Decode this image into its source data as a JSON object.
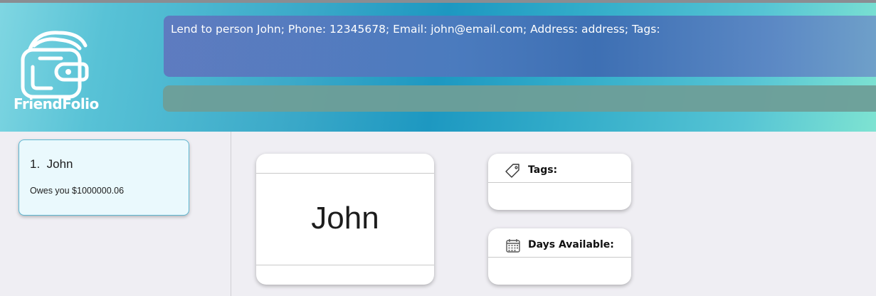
{
  "app": {
    "logo_text": "FriendFolio"
  },
  "result_display": {
    "text": "Lend to person John; Phone: 12345678; Email: john@email.com; Address: address; Tags:"
  },
  "command_box": {
    "value": ""
  },
  "person_list": [
    {
      "index": "1.",
      "name": "John",
      "balance": "Owes you $1000000.06"
    }
  ],
  "detail": {
    "name": "John",
    "tags_title": "Tags:",
    "days_title": "Days Available:"
  },
  "icons": {
    "logo": "wallet-logo-icon",
    "tags": "tag-icon",
    "days": "calendar-icon"
  },
  "colors": {
    "header_start": "#7fd6e2",
    "header_mid": "#1d98c1",
    "header_end": "#7ee3d2",
    "card_border": "#5fb7d1",
    "card_bg": "#eaf9fd"
  }
}
